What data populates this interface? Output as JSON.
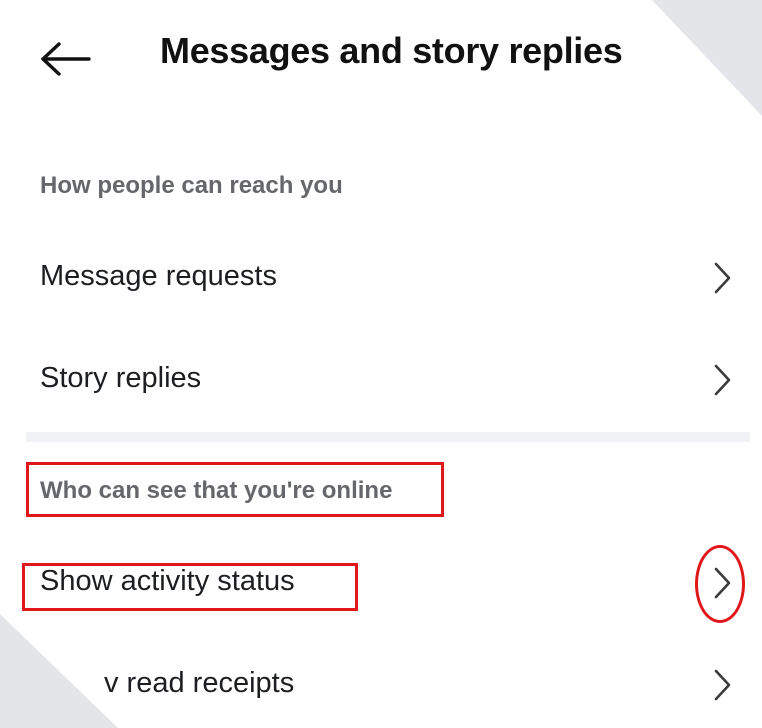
{
  "header": {
    "title": "Messages and story replies",
    "back_icon": "arrow-left-icon"
  },
  "sections": [
    {
      "title": "How people can reach you",
      "items": [
        {
          "label": "Message requests",
          "icon": "chevron-right-icon"
        },
        {
          "label": "Story replies",
          "icon": "chevron-right-icon"
        }
      ]
    },
    {
      "title": "Who can see that you're online",
      "items": [
        {
          "label": "Show activity status",
          "icon": "chevron-right-icon"
        },
        {
          "label": "v read receipts",
          "icon": "chevron-right-icon"
        }
      ]
    }
  ],
  "annotations": {
    "color": "#e0171b"
  },
  "colors": {
    "background": "#ffffff",
    "section_header": "#65676b",
    "item_text": "#1c1e21",
    "title": "#111111",
    "divider": "#f0f2f5"
  }
}
